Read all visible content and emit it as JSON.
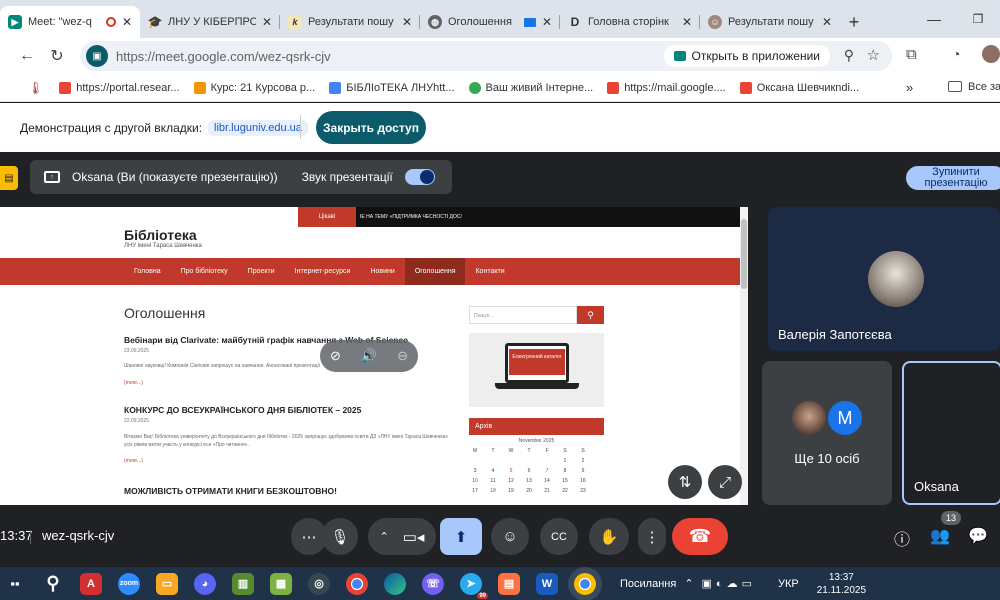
{
  "tabs": [
    {
      "title": "Meet: \"wez-q",
      "favicon": "meet-icon",
      "active": true
    },
    {
      "title": "ЛНУ У КІБЕРПРО",
      "favicon": "mortarboard-icon"
    },
    {
      "title": "Результати пошу",
      "favicon": "k-icon"
    },
    {
      "title": "Оголошення",
      "favicon": "globe-icon"
    },
    {
      "title": "Головна сторінк",
      "favicon": "d-icon"
    },
    {
      "title": "Результати пошу",
      "favicon": "person-icon"
    }
  ],
  "address": {
    "url": "https://meet.google.com/wez-qsrk-cjv",
    "open_in_app": "Открыть в приложении"
  },
  "bookmarks": [
    {
      "label": "https://portal.resear...",
      "color": "#ea4335"
    },
    {
      "label": "Курс: 21 Курсова р...",
      "color": "#f29900"
    },
    {
      "label": "БІБЛІоТЕКА ЛНУhtt...",
      "color": "#4285f4"
    },
    {
      "label": "Ваш живий Інтерне...",
      "color": "#34a853"
    },
    {
      "label": "https://mail.google....",
      "color": "#ea4335"
    },
    {
      "label": "Оксана Шевчикndi...",
      "color": "#ea4335"
    }
  ],
  "all_bookmarks": "Все закл",
  "share_banner": {
    "label": "Демонстрация с другой вкладки:",
    "domain": "libr.luguniv.edu.ua",
    "button": "Закрыть доступ"
  },
  "presenting": {
    "label": "Oksana (Ви (показуєте презентацію))",
    "audio": "Звук презентації",
    "stop_line1": "Зупинити",
    "stop_line2": "презентацію"
  },
  "site": {
    "ribbon": "Цікаві",
    "topbar": "ІЕ НА ТЕМУ «ПІДТРИМКА ЧЕСНОСТІ ДОС/",
    "title": "Бібліотека",
    "subtitle": "ЛНУ імені Тараса Шевченка",
    "nav": [
      "Головна",
      "Про бібліотеку",
      "Проекти",
      "Інтернет-ресурси",
      "Новини",
      "Оголошення",
      "Контакти"
    ],
    "heading": "Оголошення",
    "search_placeholder": "Пошук…",
    "catalog": "Електронний каталог",
    "archive": "Архів",
    "calendar_month": "November 2025",
    "weekdays": [
      "M",
      "T",
      "W",
      "T",
      "F",
      "S",
      "S"
    ],
    "calendar": [
      [
        "",
        "",
        "",
        "",
        "",
        "1",
        "2"
      ],
      [
        "3",
        "4",
        "5",
        "6",
        "7",
        "8",
        "9"
      ],
      [
        "10",
        "11",
        "12",
        "13",
        "14",
        "15",
        "16"
      ],
      [
        "17",
        "18",
        "19",
        "20",
        "21",
        "22",
        "23"
      ],
      [
        "24",
        "25",
        "26",
        "27",
        "28",
        "29",
        "30"
      ]
    ],
    "posts": [
      {
        "title": "Вебінари від Clarivate: майбутній графік навчання з Web of Science",
        "date": "23.09.2025",
        "text": "Шановні науковці! Компанія Clarivate запрошує на навчання. Анонсовані презентації",
        "more": "(more...)"
      },
      {
        "title": "КОНКУРС ДО ВСЕУКРАЇНСЬКОГО ДНЯ БІБЛІОТЕК – 2025",
        "date": "22.09.2025",
        "text": "Вітаємо Вас! Бібліотека університету до Всеукраїнського дня бібліотек - 2025 запрошує здобувачів освіти ДЗ «ЛНУ імені Тараса Шевченка» усіх рівнів взяти участь у конкурсі есе «Про читання».",
        "more": "(more...)"
      },
      {
        "title": "МОЖЛИВІСТЬ ОТРИМАТИ КНИГИ БЕЗКОШТОВНО!",
        "date": "",
        "text": "",
        "more": ""
      }
    ]
  },
  "participants": {
    "tile1_name": "Валерія Запотєєва",
    "tile2_initial": "M",
    "tile2_label": "Ще 10 осіб",
    "tile3_name": "Oksana",
    "count": "13"
  },
  "meeting": {
    "time": "13:37",
    "code": "wez-qsrk-cjv"
  },
  "taskbar": {
    "lang_label": "Посилання",
    "kbd": "УКР",
    "clock": "13:37",
    "date": "21.11.2025",
    "telegram_badge": "99"
  },
  "colors": {
    "accent": "#0b5b6b",
    "site_red": "#c0392b",
    "end_call": "#ea4335",
    "present_active": "#a8c7fa"
  }
}
